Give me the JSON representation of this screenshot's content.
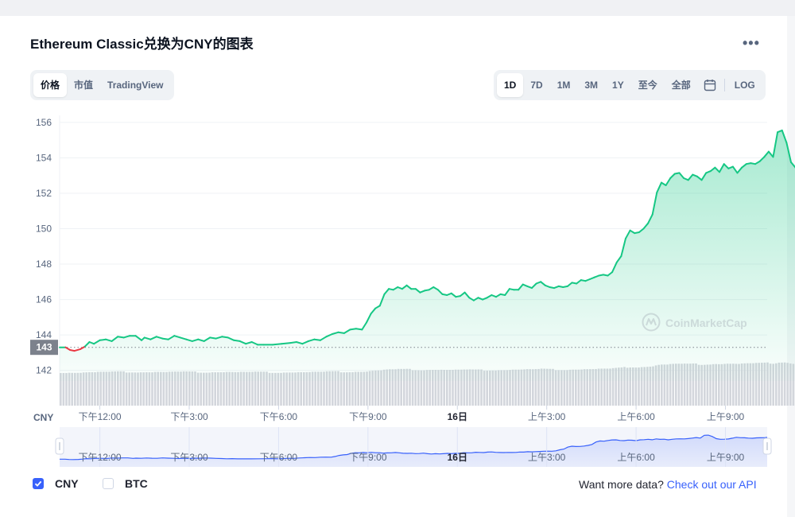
{
  "header": {
    "title": "Ethereum Classic兑换为CNY的图表",
    "more_icon": "more-horizontal-icon"
  },
  "view_tabs": [
    {
      "label": "价格",
      "active": true
    },
    {
      "label": "市值",
      "active": false
    },
    {
      "label": "TradingView",
      "active": false
    }
  ],
  "range_tabs": [
    {
      "label": "1D",
      "active": true
    },
    {
      "label": "7D",
      "active": false
    },
    {
      "label": "1M",
      "active": false
    },
    {
      "label": "3M",
      "active": false
    },
    {
      "label": "1Y",
      "active": false
    },
    {
      "label": "至今",
      "active": false
    },
    {
      "label": "全部",
      "active": false
    }
  ],
  "range_calendar_icon": "calendar-icon",
  "range_log_label": "LOG",
  "footer": {
    "legend": [
      {
        "label": "CNY",
        "checked": true
      },
      {
        "label": "BTC",
        "checked": false
      }
    ],
    "more_data_text": "Want more data?",
    "api_link_text": "Check out our API"
  },
  "chart_data": {
    "type": "area",
    "ylim": [
      141.4,
      156.4
    ],
    "y_ticks": [
      142,
      144,
      146,
      148,
      150,
      152,
      154,
      156
    ],
    "y_axis_unit": "CNY",
    "current_value_label": "143",
    "current_value": 143.3,
    "x_tick_labels": [
      "下午12:00",
      "下午3:00",
      "下午6:00",
      "下午9:00",
      "16日",
      "上午3:00",
      "上午6:00",
      "上午9:00"
    ],
    "x_tick_bold": [
      false,
      false,
      false,
      false,
      true,
      false,
      false,
      false
    ],
    "x_tick_hours": [
      12,
      15,
      18,
      21,
      24,
      27,
      30,
      33
    ],
    "x_range_hours": [
      10.65,
      34.4
    ],
    "colors": {
      "up": "#16c784",
      "down": "#ea3943",
      "volume": "#d3d6dc",
      "navigator": "#3861fb"
    },
    "watermark": "CoinMarketCap",
    "grid": true,
    "series": [
      {
        "points": [
          [
            10.65,
            143.3
          ],
          [
            10.85,
            143.3
          ],
          [
            11.0,
            143.15
          ],
          [
            11.15,
            143.1
          ],
          [
            11.35,
            143.2
          ],
          [
            11.5,
            143.35
          ],
          [
            11.65,
            143.6
          ],
          [
            11.8,
            143.5
          ],
          [
            12.0,
            143.7
          ],
          [
            12.2,
            143.75
          ],
          [
            12.4,
            143.65
          ],
          [
            12.6,
            143.9
          ],
          [
            12.8,
            143.85
          ],
          [
            13.0,
            143.95
          ],
          [
            13.2,
            143.95
          ],
          [
            13.4,
            143.7
          ],
          [
            13.5,
            143.85
          ],
          [
            13.7,
            143.75
          ],
          [
            13.9,
            143.9
          ],
          [
            14.1,
            143.8
          ],
          [
            14.3,
            143.75
          ],
          [
            14.5,
            143.95
          ],
          [
            14.7,
            143.85
          ],
          [
            14.9,
            143.75
          ],
          [
            15.1,
            143.65
          ],
          [
            15.3,
            143.75
          ],
          [
            15.5,
            143.65
          ],
          [
            15.7,
            143.85
          ],
          [
            15.9,
            143.8
          ],
          [
            16.1,
            143.9
          ],
          [
            16.3,
            143.85
          ],
          [
            16.5,
            143.7
          ],
          [
            16.7,
            143.65
          ],
          [
            16.9,
            143.5
          ],
          [
            17.1,
            143.6
          ],
          [
            17.3,
            143.45
          ],
          [
            17.5,
            143.45
          ],
          [
            17.8,
            143.45
          ],
          [
            18.1,
            143.5
          ],
          [
            18.4,
            143.55
          ],
          [
            18.6,
            143.6
          ],
          [
            18.8,
            143.5
          ],
          [
            19.0,
            143.65
          ],
          [
            19.2,
            143.75
          ],
          [
            19.4,
            143.7
          ],
          [
            19.6,
            143.9
          ],
          [
            19.8,
            144.05
          ],
          [
            20.0,
            144.15
          ],
          [
            20.2,
            144.1
          ],
          [
            20.4,
            144.3
          ],
          [
            20.6,
            144.35
          ],
          [
            20.8,
            144.3
          ],
          [
            20.95,
            144.7
          ],
          [
            21.1,
            145.2
          ],
          [
            21.25,
            145.5
          ],
          [
            21.4,
            145.65
          ],
          [
            21.55,
            146.3
          ],
          [
            21.7,
            146.6
          ],
          [
            21.85,
            146.55
          ],
          [
            22.0,
            146.7
          ],
          [
            22.15,
            146.6
          ],
          [
            22.3,
            146.8
          ],
          [
            22.45,
            146.6
          ],
          [
            22.6,
            146.6
          ],
          [
            22.75,
            146.4
          ],
          [
            22.9,
            146.5
          ],
          [
            23.05,
            146.55
          ],
          [
            23.2,
            146.7
          ],
          [
            23.35,
            146.55
          ],
          [
            23.5,
            146.3
          ],
          [
            23.65,
            146.25
          ],
          [
            23.8,
            146.35
          ],
          [
            23.95,
            146.15
          ],
          [
            24.1,
            146.2
          ],
          [
            24.25,
            146.4
          ],
          [
            24.4,
            146.1
          ],
          [
            24.55,
            145.95
          ],
          [
            24.7,
            146.1
          ],
          [
            24.85,
            146.0
          ],
          [
            25.0,
            146.1
          ],
          [
            25.15,
            146.25
          ],
          [
            25.3,
            146.15
          ],
          [
            25.45,
            146.3
          ],
          [
            25.6,
            146.25
          ],
          [
            25.75,
            146.6
          ],
          [
            25.9,
            146.55
          ],
          [
            26.05,
            146.55
          ],
          [
            26.2,
            146.85
          ],
          [
            26.35,
            146.75
          ],
          [
            26.5,
            146.65
          ],
          [
            26.65,
            146.9
          ],
          [
            26.8,
            147.0
          ],
          [
            26.95,
            146.8
          ],
          [
            27.1,
            146.7
          ],
          [
            27.25,
            146.65
          ],
          [
            27.4,
            146.75
          ],
          [
            27.55,
            146.7
          ],
          [
            27.7,
            146.75
          ],
          [
            27.85,
            146.95
          ],
          [
            28.0,
            146.9
          ],
          [
            28.15,
            147.1
          ],
          [
            28.3,
            147.05
          ],
          [
            28.45,
            147.15
          ],
          [
            28.6,
            147.25
          ],
          [
            28.75,
            147.35
          ],
          [
            28.9,
            147.4
          ],
          [
            29.05,
            147.35
          ],
          [
            29.2,
            147.55
          ],
          [
            29.35,
            148.1
          ],
          [
            29.5,
            148.45
          ],
          [
            29.65,
            149.45
          ],
          [
            29.8,
            149.9
          ],
          [
            29.95,
            149.75
          ],
          [
            30.1,
            149.8
          ],
          [
            30.25,
            150.0
          ],
          [
            30.4,
            150.3
          ],
          [
            30.55,
            150.8
          ],
          [
            30.7,
            152.05
          ],
          [
            30.85,
            152.6
          ],
          [
            31.0,
            152.45
          ],
          [
            31.15,
            152.85
          ],
          [
            31.3,
            153.1
          ],
          [
            31.45,
            153.15
          ],
          [
            31.6,
            152.85
          ],
          [
            31.75,
            152.75
          ],
          [
            31.9,
            153.05
          ],
          [
            32.05,
            152.95
          ],
          [
            32.2,
            152.75
          ],
          [
            32.35,
            153.15
          ],
          [
            32.5,
            153.25
          ],
          [
            32.65,
            153.45
          ],
          [
            32.8,
            153.2
          ],
          [
            32.95,
            153.65
          ],
          [
            33.1,
            153.4
          ],
          [
            33.25,
            153.5
          ],
          [
            33.4,
            153.15
          ],
          [
            33.55,
            153.45
          ],
          [
            33.7,
            153.65
          ],
          [
            33.85,
            153.7
          ],
          [
            34.0,
            153.65
          ],
          [
            34.15,
            153.8
          ],
          [
            34.3,
            154.05
          ],
          [
            34.45,
            154.35
          ],
          [
            34.6,
            154.05
          ],
          [
            34.75,
            155.45
          ],
          [
            34.9,
            155.55
          ],
          [
            35.05,
            154.85
          ],
          [
            35.2,
            153.75
          ],
          [
            35.35,
            153.45
          ],
          [
            35.5,
            153.5
          ],
          [
            35.65,
            153.6
          ],
          [
            35.8,
            154.0
          ],
          [
            35.95,
            154.45
          ],
          [
            36.1,
            154.25
          ],
          [
            36.25,
            154.2
          ],
          [
            36.4,
            154.05
          ],
          [
            36.55,
            153.95
          ],
          [
            36.7,
            154.15
          ],
          [
            36.85,
            154.2
          ],
          [
            37.0,
            154.25
          ],
          [
            37.1,
            154.45
          ]
        ]
      }
    ]
  }
}
